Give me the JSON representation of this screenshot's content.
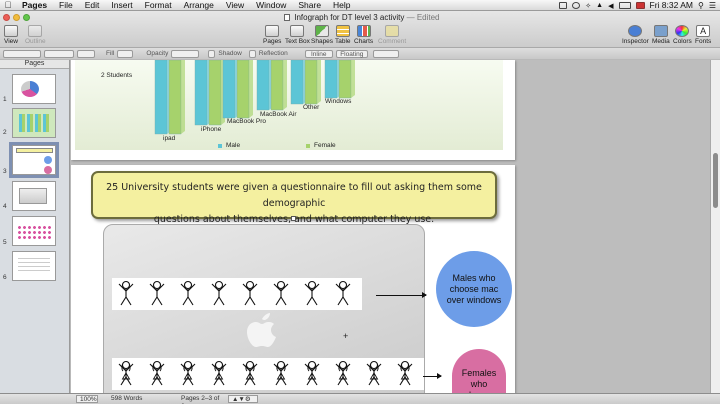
{
  "menubar": {
    "app": "Pages",
    "items": [
      "File",
      "Edit",
      "Insert",
      "Format",
      "Arrange",
      "View",
      "Window",
      "Share",
      "Help"
    ],
    "clock": "Fri 8:32 AM"
  },
  "window": {
    "title": "Infograph for DT level 3 activity",
    "status": "— Edited"
  },
  "toolbar": {
    "left": [
      "View",
      "Outline"
    ],
    "center": [
      "Pages",
      "Text Box",
      "Shapes",
      "Table",
      "Charts",
      "Comment"
    ],
    "right": [
      "Inspector",
      "Media",
      "Colors",
      "Fonts"
    ]
  },
  "formatbar": {
    "fill_label": "Fill",
    "opacity_label": "Opacity",
    "shadow_label": "Shadow",
    "reflection_label": "Reflection",
    "wrap_inline": "Inline",
    "wrap_floating": "Floating"
  },
  "sidebar": {
    "header": "Pages",
    "thumbnails": [
      "1",
      "2",
      "3",
      "4",
      "5",
      "6"
    ],
    "selected": "3"
  },
  "chart": {
    "y_label": "2  Students",
    "categories": [
      "ipad",
      "iPhone",
      "MacBook Pro",
      "MacBook Air",
      "Other",
      "Windows"
    ],
    "legend_male": "Male",
    "legend_female": "Female",
    "colors": {
      "male": "#5cc5d6",
      "female": "#a6d26c"
    }
  },
  "callout": {
    "line1": "25 University students were given a questionnaire to fill out asking them some demographic",
    "line2": "questions about themselves, and what computer they use."
  },
  "bubbles": {
    "males": "Males who choose mac over windows",
    "females": "Females who choose",
    "male_color": "#6d9de8",
    "female_color": "#d86ea2"
  },
  "status": {
    "zoom": "100%",
    "words": "598 Words",
    "pages": "Pages 2–3 of 6"
  }
}
